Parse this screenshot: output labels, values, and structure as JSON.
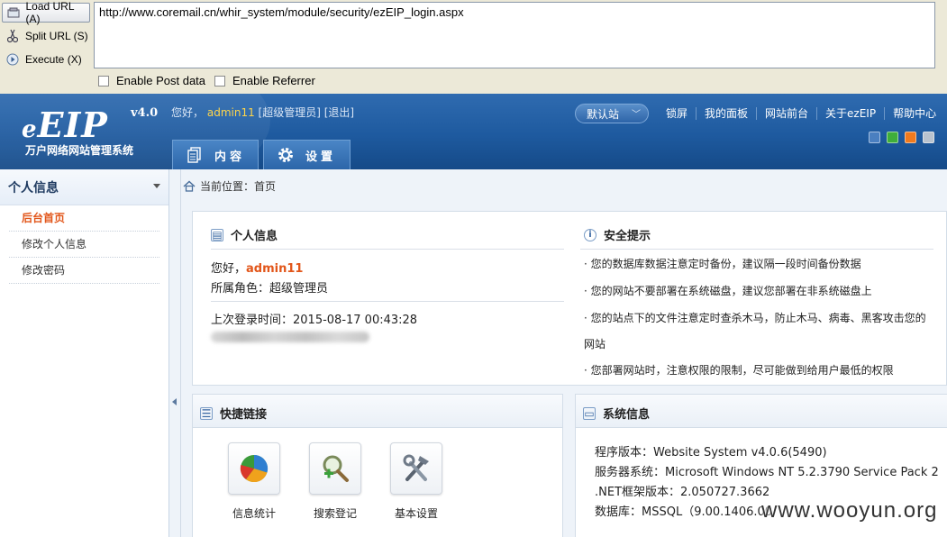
{
  "hackbar": {
    "load_url_label": "Load URL (A)",
    "split_url_label": "Split URL (S)",
    "execute_label": "Execute (X)",
    "url_value": "http://www.coremail.cn/whir_system/module/security/ezEIP_login.aspx",
    "enable_post_label": "Enable Post data",
    "enable_referrer_label": "Enable Referrer"
  },
  "header": {
    "logo_text": "EIP",
    "logo_prefix": "e",
    "logo_version": "v4.0",
    "logo_subtitle": "万户网络网站管理系统",
    "greeting_prefix": "您好，",
    "user_name": "admin11",
    "role_and_logout": "[超级管理员] [退出]",
    "site_select": "默认站",
    "nav_links": [
      "锁屏",
      "我的面板",
      "网站前台",
      "关于ezEIP",
      "帮助中心"
    ],
    "skin_colors": [
      "#4a7fc0",
      "#3fae3a",
      "#f07a1e",
      "#b9c3cf"
    ],
    "tabs": [
      {
        "label": "内容",
        "icon": "document-icon"
      },
      {
        "label": "设置",
        "icon": "gear-icon"
      }
    ]
  },
  "sidebar": {
    "title": "个人信息",
    "items": [
      "后台首页",
      "修改个人信息",
      "修改密码"
    ],
    "active_index": 0
  },
  "breadcrumb": {
    "label": "当前位置：",
    "current": "首页"
  },
  "personal_info": {
    "title": "个人信息",
    "hello_prefix": "您好，",
    "hello_name": "admin11",
    "role_line": "所属角色：超级管理员",
    "last_login": "上次登录时间：2015-08-17 00:43:28"
  },
  "security_tips": {
    "title": "安全提示",
    "tips": [
      "· 您的数据库数据注意定时备份，建议隔一段时间备份数据",
      "· 您的网站不要部署在系统磁盘，建议您部署在非系统磁盘上",
      "· 您的站点下的文件注意定时查杀木马，防止木马、病毒、黑客攻击您的网站",
      "· 您部署网站时，注意权限的限制，尽可能做到给用户最低的权限"
    ]
  },
  "quick_links": {
    "title": "快捷链接",
    "items": [
      {
        "label": "信息统计",
        "icon": "pie-chart-icon"
      },
      {
        "label": "搜索登记",
        "icon": "search-add-icon"
      },
      {
        "label": "基本设置",
        "icon": "tools-icon"
      }
    ]
  },
  "system_info": {
    "title": "系统信息",
    "lines": [
      "程序版本：Website System v4.0.6(5490)",
      "服务器系统：Microsoft Windows NT 5.2.3790 Service Pack 2",
      ".NET框架版本：2.050727.3662",
      "数据库：MSSQL（9.00.1406.00"
    ]
  },
  "watermark": "www.wooyun.org"
}
